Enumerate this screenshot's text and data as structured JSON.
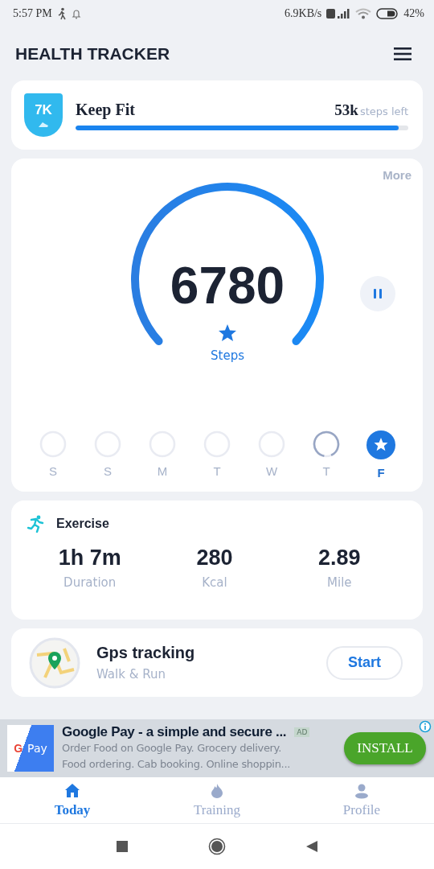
{
  "status_bar": {
    "time": "5:57 PM",
    "speed": "6.9KB/s",
    "battery": "42%"
  },
  "header": {
    "title": "HEALTH TRACKER"
  },
  "goal": {
    "badge": "7K",
    "name": "Keep Fit",
    "remaining": "53k",
    "remaining_unit": "steps left",
    "level": 0.97
  },
  "steps": {
    "more": "More",
    "count": "6780",
    "label": "Steps",
    "paused": false
  },
  "days": [
    {
      "label": "S",
      "kind": "empty",
      "selected": false
    },
    {
      "label": "S",
      "kind": "empty",
      "selected": false
    },
    {
      "label": "M",
      "kind": "empty",
      "selected": false
    },
    {
      "label": "T",
      "kind": "empty",
      "selected": false
    },
    {
      "label": "W",
      "kind": "empty",
      "selected": false
    },
    {
      "label": "T",
      "kind": "partial",
      "selected": false
    },
    {
      "label": "F",
      "kind": "done",
      "selected": true
    }
  ],
  "exercise": {
    "title": "Exercise",
    "stats": [
      {
        "value": "1h 7m",
        "label": "Duration"
      },
      {
        "value": "280",
        "label": "Kcal"
      },
      {
        "value": "2.89",
        "label": "Mile"
      }
    ]
  },
  "gps": {
    "title": "Gps tracking",
    "subtitle": "Walk & Run",
    "button": "Start"
  },
  "ad": {
    "logo_g": "G",
    "logo_text": "Pay",
    "title": "Google Pay - a simple and secure ...",
    "tag": "AD",
    "lines": [
      "Order Food on Google Pay. Grocery delivery.",
      "Food ordering. Cab booking. Online shoppin..."
    ],
    "button": "INSTALL"
  },
  "tabs": [
    {
      "kind": "home",
      "label": "Today",
      "selected": true
    },
    {
      "kind": "flame",
      "label": "Training",
      "selected": false
    },
    {
      "kind": "person",
      "label": "Profile",
      "selected": false
    }
  ]
}
